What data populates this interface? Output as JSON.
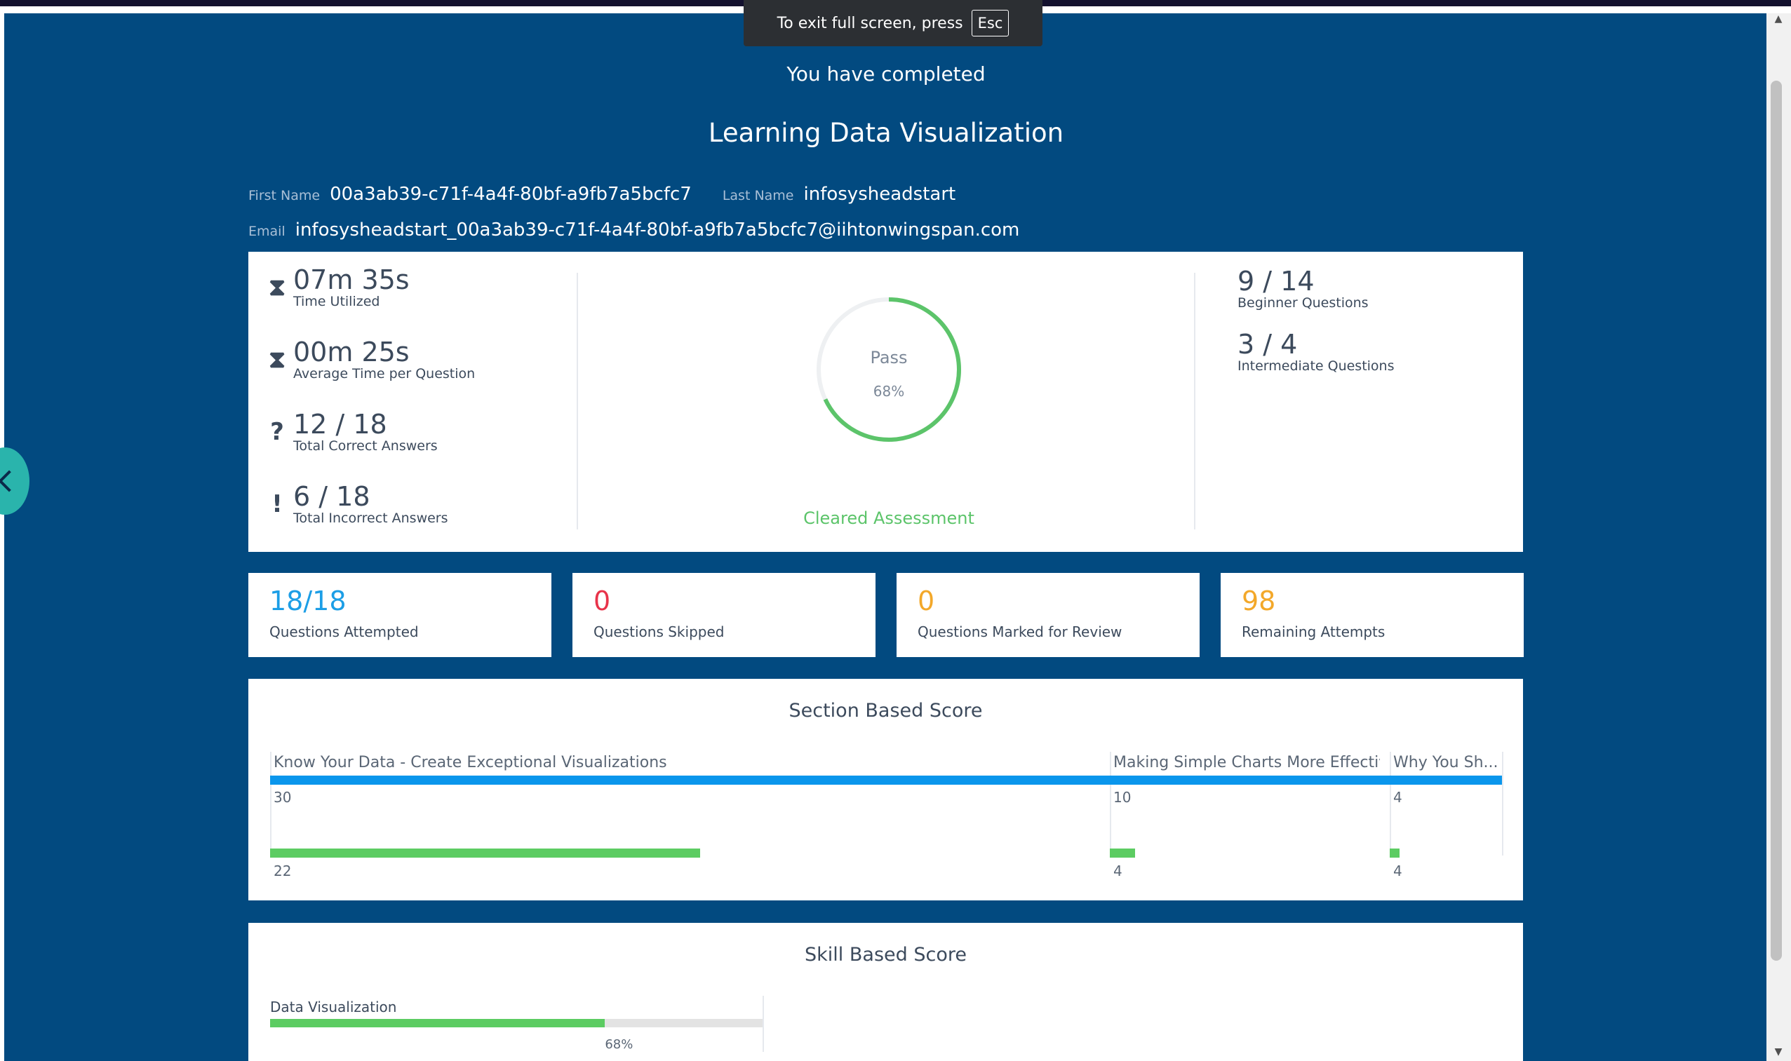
{
  "fullscreen_banner": {
    "text": "To exit full screen, press",
    "key": "Esc"
  },
  "header": {
    "completed_text": "You have completed",
    "course_title": "Learning Data Visualization"
  },
  "user": {
    "first_name_label": "First Name",
    "first_name": "00a3ab39-c71f-4a4f-80bf-a9fb7a5bcfc7",
    "last_name_label": "Last Name",
    "last_name": "infosysheadstart",
    "email_label": "Email",
    "email": "infosysheadstart_00a3ab39-c71f-4a4f-80bf-a9fb7a5bcfc7@iihtonwingspan.com"
  },
  "stats": {
    "time_utilized": {
      "value": "07m 35s",
      "label": "Time Utilized",
      "icon": "hourglass-icon"
    },
    "avg_time": {
      "value": "00m 25s",
      "label": "Average Time per Question",
      "icon": "hourglass-icon"
    },
    "correct": {
      "value": "12 / 18",
      "label": "Total Correct Answers",
      "icon": "question-icon"
    },
    "incorrect": {
      "value": "6 / 18",
      "label": "Total Incorrect Answers",
      "icon": "exclamation-icon"
    }
  },
  "result": {
    "status": "Pass",
    "percent": "68%",
    "fraction": 0.68,
    "message": "Cleared Assessment"
  },
  "question_levels": {
    "beginner": {
      "value": "9 / 14",
      "label": "Beginner Questions"
    },
    "intermediate": {
      "value": "3 / 4",
      "label": "Intermediate Questions"
    }
  },
  "summary_cards": [
    {
      "value": "18/18",
      "label": "Questions Attempted",
      "color": "#1c9ee6"
    },
    {
      "value": "0",
      "label": "Questions Skipped",
      "color": "#e8334a"
    },
    {
      "value": "0",
      "label": "Questions Marked for Review",
      "color": "#f3a82a"
    },
    {
      "value": "98",
      "label": "Remaining Attempts",
      "color": "#f3a82a"
    }
  ],
  "section_score": {
    "title": "Section Based Score",
    "sections": [
      {
        "name": "Know Your Data - Create Exceptional Visualizations",
        "total": "30",
        "score": "22",
        "total_num": 30,
        "score_num": 22
      },
      {
        "name": "Making Simple Charts More Effective",
        "total": "10",
        "score": "4",
        "total_num": 10,
        "score_num": 4
      },
      {
        "name": "Why You Sh...",
        "total": "4",
        "score": "4",
        "total_num": 4,
        "score_num": 4
      }
    ]
  },
  "skill_score": {
    "title": "Skill Based Score",
    "skills": [
      {
        "name": "Data Visualization",
        "percent": "68%",
        "fraction": 0.68
      }
    ]
  },
  "colors": {
    "background": "#024a80",
    "pass_green": "#5cc46a",
    "total_blue": "#0a96ec"
  }
}
